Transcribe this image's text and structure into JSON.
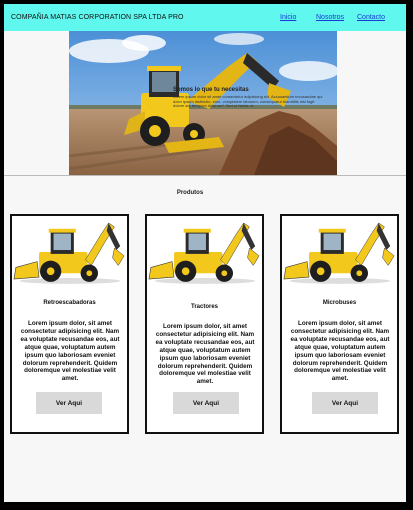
{
  "navbar": {
    "brand": "COMPAÑIA MATIAS  CORPORATION SPA LTDA PRO",
    "links": [
      "Inicio",
      "Nosotros",
      "Contacto"
    ]
  },
  "hero": {
    "title": "Somos lo que tu necesitas",
    "text": "Lorem ipsum dolor sit amet consectetur adipisicing elit. Accusantium recusandae qui dolor ipsum distinctio, eum, voluptatem laborum, consequatur blanditiis nisi fugit dolore ad, tempora dolorum? Sed et Nobis ut."
  },
  "products": {
    "title": "Produtos",
    "cards": [
      {
        "title": "Retroescabadoras",
        "text": "Lorem ipsum dolor, sit amet consectetur adipisicing elit. Nam ea voluptate recusandae eos, aut atque quae, voluptatum autem ipsum quo laboriosam eveniet dolorum reprehenderit. Quidem doloremque vel molestiae velit amet.",
        "button": "Ver Aqui"
      },
      {
        "title": "Tractores",
        "text": "Lorem ipsum dolor, sit amet consectetur adipisicing elit. Nam ea voluptate recusandae eos, aut atque quae, voluptatum autem ipsum quo laboriosam eveniet dolorum reprehenderit. Quidem doloremque vel molestiae velit amet.",
        "button": "Ver Aqui"
      },
      {
        "title": "Microbuses",
        "text": "Lorem ipsum dolor, sit amet consectetur adipisicing elit. Nam ea voluptate recusandae eos, aut atque quae, voluptatum autem ipsum quo laboriosam eveniet dolorum reprehenderit. Quidem doloremque vel molestiae velit amet.",
        "button": "Ver Aqui"
      }
    ]
  },
  "colors": {
    "navbar": "#5ff7ee",
    "link": "#1a3ad6",
    "button": "#d9d9d9",
    "machine_yellow": "#f2c81c"
  }
}
